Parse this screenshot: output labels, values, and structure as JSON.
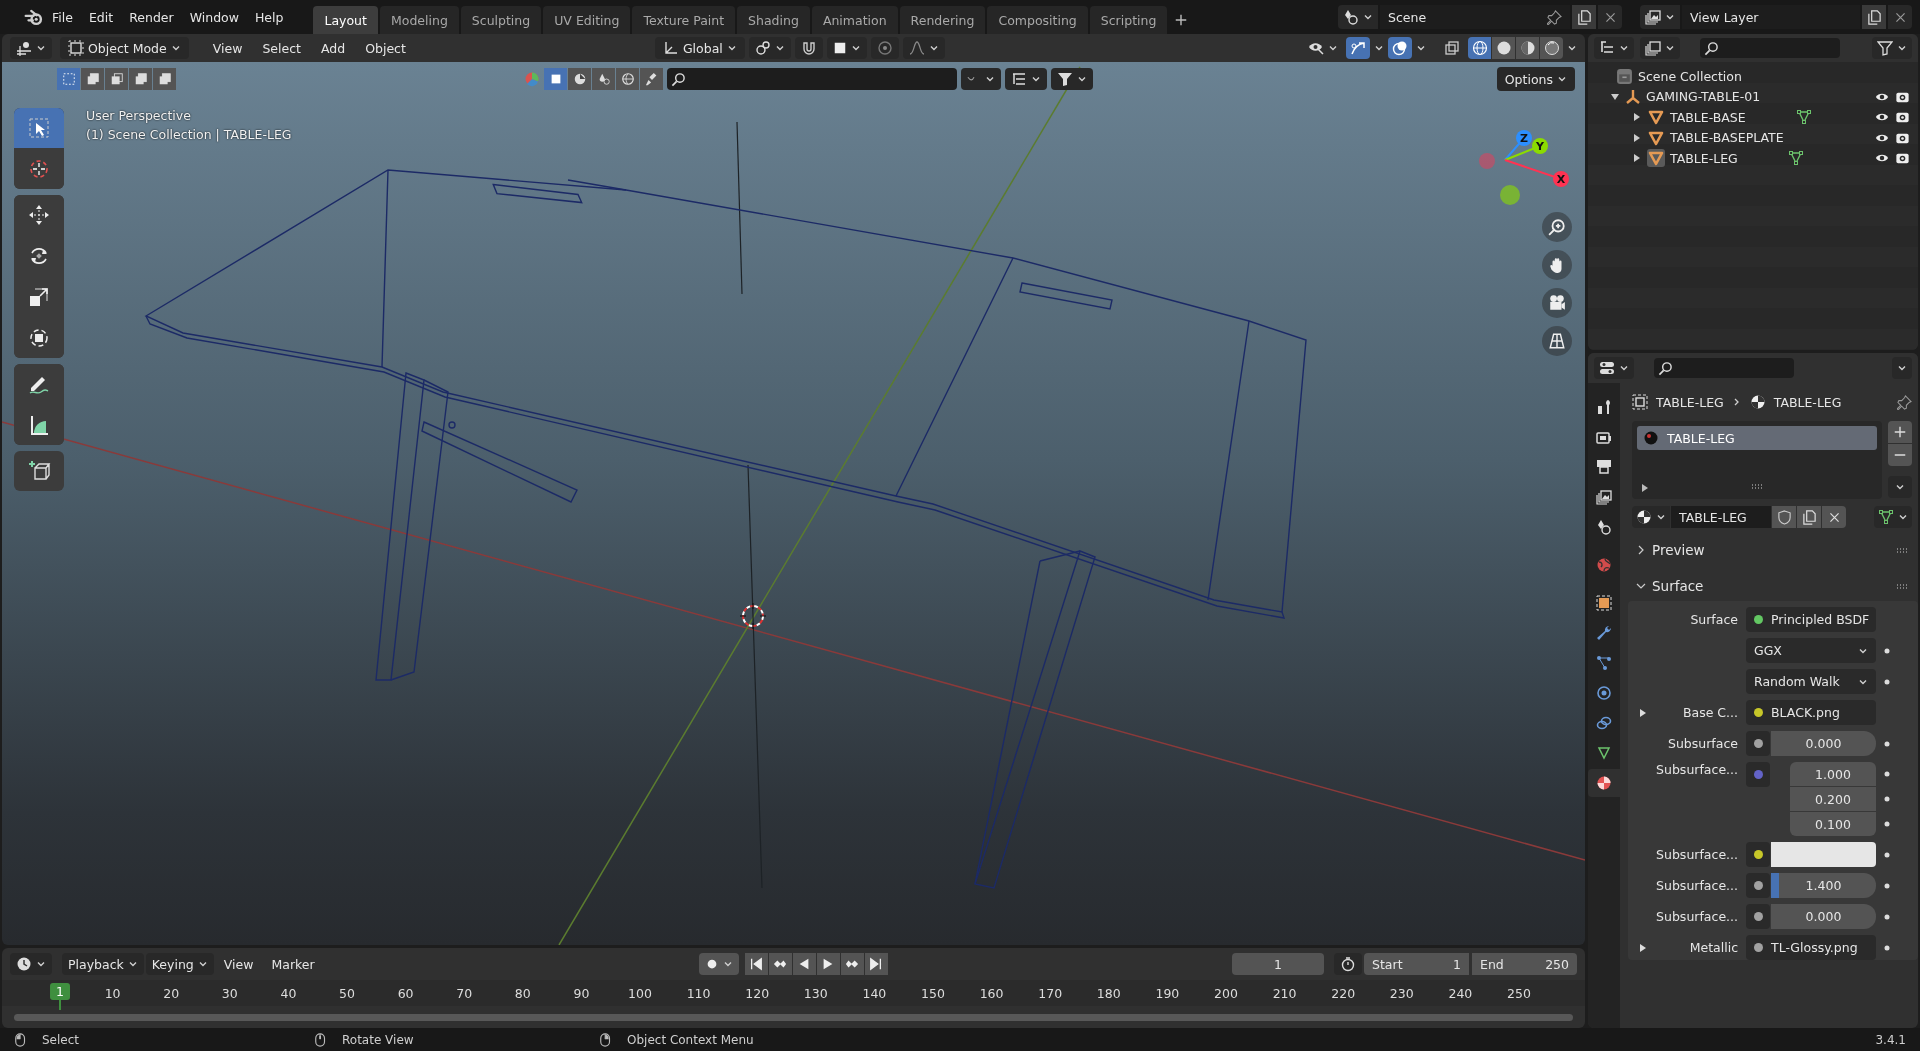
{
  "menu": [
    "File",
    "Edit",
    "Render",
    "Window",
    "Help"
  ],
  "workspaces": [
    {
      "label": "Layout",
      "selected": true
    },
    {
      "label": "Modeling",
      "selected": false
    },
    {
      "label": "Sculpting",
      "selected": false
    },
    {
      "label": "UV Editing",
      "selected": false
    },
    {
      "label": "Texture Paint",
      "selected": false
    },
    {
      "label": "Shading",
      "selected": false
    },
    {
      "label": "Animation",
      "selected": false
    },
    {
      "label": "Rendering",
      "selected": false
    },
    {
      "label": "Compositing",
      "selected": false
    },
    {
      "label": "Scripting",
      "selected": false
    }
  ],
  "scene": "Scene",
  "view_layer": "View Layer",
  "viewport": {
    "mode": "Object Mode",
    "menu": [
      "View",
      "Select",
      "Add",
      "Object"
    ],
    "orientation": "Global",
    "options": "Options",
    "overlay_text": [
      "User Perspective",
      "(1) Scene Collection | TABLE-LEG"
    ],
    "axes": [
      {
        "label": "Z",
        "color": "#2c8fff"
      },
      {
        "label": "Y",
        "color": "#8bdc00"
      },
      {
        "label": "X",
        "color": "#ff3352"
      }
    ],
    "shading": [
      {
        "kind": "wireframe",
        "selected": true
      },
      {
        "kind": "solid",
        "selected": false
      },
      {
        "kind": "material",
        "selected": false
      },
      {
        "kind": "rendered",
        "selected": false
      }
    ],
    "tool_groups": [
      [
        {
          "kind": "select",
          "selected": true
        },
        {
          "kind": "cursor",
          "selected": false
        }
      ],
      [
        {
          "kind": "move",
          "selected": false
        },
        {
          "kind": "rotate",
          "selected": false
        },
        {
          "kind": "scale",
          "selected": false
        },
        {
          "kind": "transform",
          "selected": false
        }
      ],
      [
        {
          "kind": "annotate",
          "selected": false
        },
        {
          "kind": "measure",
          "selected": false
        }
      ],
      [
        {
          "kind": "add_cube",
          "selected": false
        }
      ]
    ]
  },
  "outliner": {
    "root": "Scene Collection",
    "items": [
      {
        "label": "GAMING-TABLE-01",
        "kind": "empty",
        "expanded": true,
        "children": [
          {
            "label": "TABLE-BASE",
            "kind": "mesh",
            "expanded": false,
            "active": false,
            "has_data": true
          },
          {
            "label": "TABLE-BASEPLATE",
            "kind": "mesh",
            "expanded": false,
            "active": false,
            "has_data": false
          },
          {
            "label": "TABLE-LEG",
            "kind": "mesh",
            "expanded": false,
            "active": true,
            "has_data": true
          }
        ]
      }
    ]
  },
  "properties": {
    "tabs": [
      {
        "kind": "tool",
        "selected": false
      },
      {
        "kind": "render",
        "selected": false
      },
      {
        "kind": "output",
        "selected": false
      },
      {
        "kind": "view_layer",
        "selected": false
      },
      {
        "kind": "scene",
        "selected": false
      },
      {
        "kind": "world",
        "selected": false
      },
      {
        "kind": "object",
        "selected": false
      },
      {
        "kind": "modifiers",
        "selected": false
      },
      {
        "kind": "particles",
        "selected": false
      },
      {
        "kind": "physics",
        "selected": false
      },
      {
        "kind": "constraints",
        "selected": false
      },
      {
        "kind": "data",
        "selected": false
      },
      {
        "kind": "material",
        "selected": true
      }
    ],
    "breadcrumb": [
      "TABLE-LEG",
      "TABLE-LEG"
    ],
    "slots": [
      {
        "label": "TABLE-LEG",
        "selected": true
      }
    ],
    "material": "TABLE-LEG",
    "panels": [
      {
        "title": "Preview",
        "expanded": false
      },
      {
        "title": "Surface",
        "expanded": true,
        "rows": [
          {
            "kind": "link",
            "label": "Surface",
            "color": "#63c763",
            "value": "Principled BSDF",
            "expandable": false,
            "animatable": false
          },
          {
            "kind": "dropdown",
            "value": "GGX",
            "animatable": true
          },
          {
            "kind": "dropdown",
            "value": "Random Walk",
            "animatable": true
          },
          {
            "kind": "link",
            "label": "Base C...",
            "color": "#c7c729",
            "value": "BLACK.png",
            "expandable": true,
            "animatable": false
          },
          {
            "kind": "number",
            "label": "Subsurface",
            "color": "#a1a1a1",
            "value": "0.000",
            "animatable": true
          },
          {
            "kind": "vector",
            "label": "Subsurface...",
            "color": "#6363c7",
            "values": [
              "1.000",
              "0.200",
              "0.100"
            ],
            "animatable": true
          },
          {
            "kind": "swatch",
            "label": "Subsurface...",
            "color": "#c7c729",
            "animatable": true
          },
          {
            "kind": "slider",
            "label": "Subsurface...",
            "color": "#a1a1a1",
            "value": "1.400",
            "level": 0.08,
            "animatable": true
          },
          {
            "kind": "number",
            "label": "Subsurface...",
            "color": "#a1a1a1",
            "value": "0.000",
            "animatable": true
          },
          {
            "kind": "link",
            "label": "Metallic",
            "color": "#a1a1a1",
            "value": "TL-Glossy.png",
            "expandable": true,
            "animatable": true
          }
        ]
      }
    ]
  },
  "timeline": {
    "menu": [
      "Playback",
      "Keying",
      "View",
      "Marker"
    ],
    "current_frame": "1",
    "start_label": "Start",
    "start": "1",
    "end_label": "End",
    "end": "250",
    "ruler": [
      {
        "label": "1",
        "current": true
      },
      {
        "label": "10",
        "current": false
      },
      {
        "label": "20",
        "current": false
      },
      {
        "label": "30",
        "current": false
      },
      {
        "label": "40",
        "current": false
      },
      {
        "label": "50",
        "current": false
      },
      {
        "label": "60",
        "current": false
      },
      {
        "label": "70",
        "current": false
      },
      {
        "label": "80",
        "current": false
      },
      {
        "label": "90",
        "current": false
      },
      {
        "label": "100",
        "current": false
      },
      {
        "label": "110",
        "current": false
      },
      {
        "label": "120",
        "current": false
      },
      {
        "label": "130",
        "current": false
      },
      {
        "label": "140",
        "current": false
      },
      {
        "label": "150",
        "current": false
      },
      {
        "label": "160",
        "current": false
      },
      {
        "label": "170",
        "current": false
      },
      {
        "label": "180",
        "current": false
      },
      {
        "label": "190",
        "current": false
      },
      {
        "label": "200",
        "current": false
      },
      {
        "label": "210",
        "current": false
      },
      {
        "label": "220",
        "current": false
      },
      {
        "label": "230",
        "current": false
      },
      {
        "label": "240",
        "current": false
      },
      {
        "label": "250",
        "current": false
      }
    ]
  },
  "status": {
    "hints": [
      "Select",
      "Rotate View",
      "Object Context Menu"
    ],
    "version": "3.4.1"
  }
}
